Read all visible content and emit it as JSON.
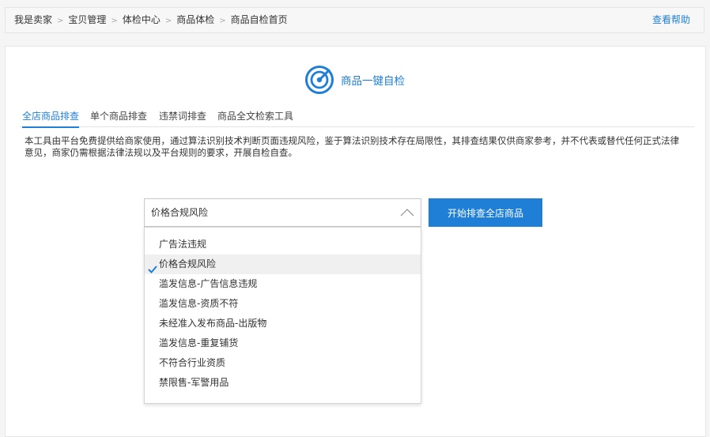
{
  "breadcrumb": {
    "items": [
      "我是卖家",
      "宝贝管理",
      "体检中心",
      "商品体检",
      "商品自检首页"
    ],
    "separator": ">"
  },
  "help_link": "查看帮助",
  "header": {
    "title": "商品一键自检"
  },
  "tabs": [
    {
      "label": "全店商品排查",
      "active": true
    },
    {
      "label": "单个商品排查",
      "active": false
    },
    {
      "label": "违禁词排查",
      "active": false
    },
    {
      "label": "商品全文检索工具",
      "active": false
    }
  ],
  "notice": "本工具由平台免费提供给商家使用，通过算法识别技术判断页面违规风险，鉴于算法识别技术存在局限性，其排查结果仅供商家参考，并不代表或替代任何正式法律意见，商家仍需根据法律法规以及平台规则的要求，开展自检自查。",
  "select": {
    "value": "价格合规风险"
  },
  "start_button": "开始排查全店商品",
  "dropdown": {
    "options": [
      {
        "label": "广告法违规",
        "selected": false
      },
      {
        "label": "价格合规风险",
        "selected": true
      },
      {
        "label": "滥发信息-广告信息违规",
        "selected": false
      },
      {
        "label": "滥发信息-资质不符",
        "selected": false
      },
      {
        "label": "未经准入发布商品-出版物",
        "selected": false
      },
      {
        "label": "滥发信息-重复铺货",
        "selected": false
      },
      {
        "label": "不符合行业资质",
        "selected": false
      },
      {
        "label": "禁限售-军警用品",
        "selected": false
      }
    ]
  },
  "colors": {
    "accent": "#1f7fd6"
  },
  "icons": {
    "brand": "radar-target-icon",
    "select_arrow": "chevron-up-icon",
    "check": "checkmark-icon"
  }
}
